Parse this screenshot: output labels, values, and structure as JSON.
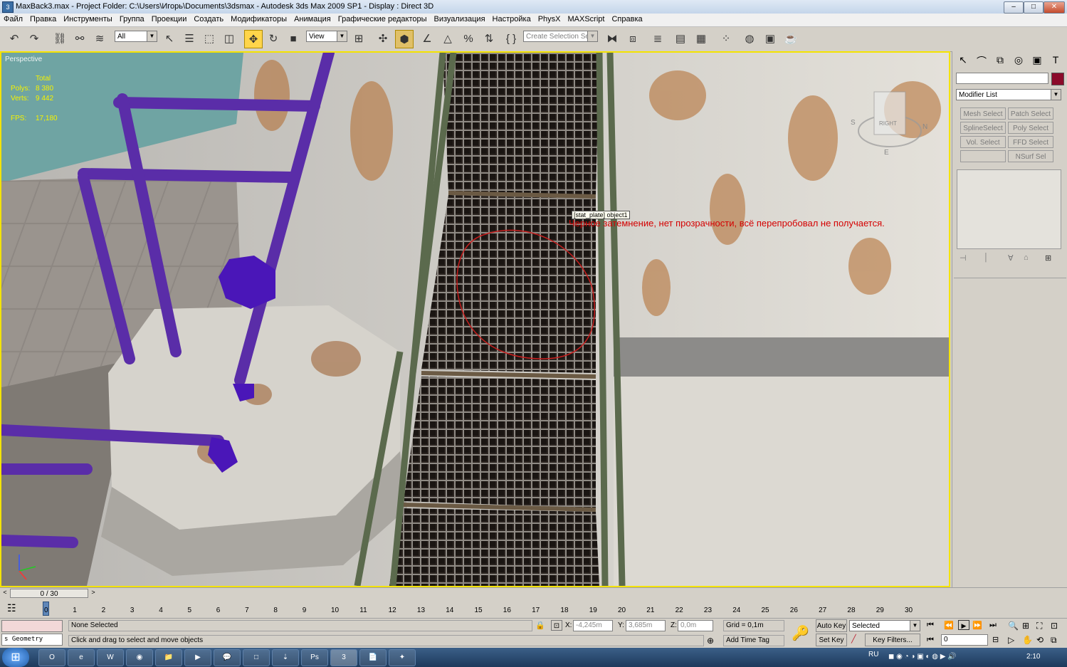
{
  "title_bar": {
    "text": "MaxBack3.max    - Project Folder: C:\\Users\\Игорь\\Documents\\3dsmax    - Autodesk 3ds Max  2009 SP1      - Display : Direct 3D",
    "app_icon": "3ds-max-icon",
    "minimize": "–",
    "maximize": "□",
    "close": "✕"
  },
  "menu": [
    "Файл",
    "Правка",
    "Инструменты",
    "Группа",
    "Проекции",
    "Создать",
    "Модификаторы",
    "Анимация",
    "Графические редакторы",
    "Визуализация",
    "Настройка",
    "PhysX",
    "MAXScript",
    "Справка"
  ],
  "toolbar": {
    "selection_filter": "All",
    "reference_coord": "View",
    "named_selection_placeholder": "Create Selection Se"
  },
  "viewport": {
    "label": "Perspective",
    "stats": {
      "header": "Total",
      "polys_label": "Polys:",
      "polys_value": "8 380",
      "verts_label": "Verts:",
      "verts_value": "9 442",
      "fps_label": "FPS:",
      "fps_value": "17,180"
    },
    "tooltip": "[stat_plate] object1",
    "annotation": "Черное затемнение, нет прозрачности, всё перепробовал не получается.",
    "viewcube": {
      "face": "RIGHT",
      "south": "S",
      "north": "N",
      "east": "E"
    },
    "accent_color": "#f4e300",
    "annotation_color": "#d40000"
  },
  "command_panel": {
    "modifier_list": "Modifier List",
    "name_value": "",
    "color_swatch": "#8b0a2a",
    "modifier_buttons": [
      "Mesh Select",
      "Patch Select",
      "SplineSelect",
      "Poly Select",
      "Vol. Select",
      "FFD Select",
      "",
      "NSurf Sel"
    ]
  },
  "time_slider": {
    "frame_display": "0 / 30",
    "prev": "<",
    "next": ">"
  },
  "track_ticks": [
    "0",
    "1",
    "2",
    "3",
    "4",
    "5",
    "6",
    "7",
    "8",
    "9",
    "10",
    "11",
    "12",
    "13",
    "14",
    "15",
    "16",
    "17",
    "18",
    "19",
    "20",
    "21",
    "22",
    "23",
    "24",
    "25",
    "26",
    "27",
    "28",
    "29",
    "30"
  ],
  "status": {
    "maxscript_listener": "",
    "geometry_label": "s  Geometry",
    "selection_text": "None Selected",
    "prompt_text": "Click and drag to select and move objects",
    "x_label": "X:",
    "x_value": "-4,245m",
    "y_label": "Y:",
    "y_value": "3,685m",
    "z_label": "Z:",
    "z_value": "0,0m",
    "grid": "Grid = 0,1m",
    "add_time_tag": "Add Time Tag",
    "auto_key": "Auto Key",
    "set_key": "Set Key",
    "key_mode": "Selected",
    "key_filters": "Key Filters...",
    "frame_field": "0"
  },
  "taskbar": {
    "start": "⊞",
    "items": [
      "O",
      "e",
      "W",
      "◉",
      "📁",
      "▶",
      "💬",
      "□",
      "⇣",
      "Ps",
      "3",
      "📄",
      "✦"
    ],
    "lang": "RU",
    "clock": "2:10"
  }
}
